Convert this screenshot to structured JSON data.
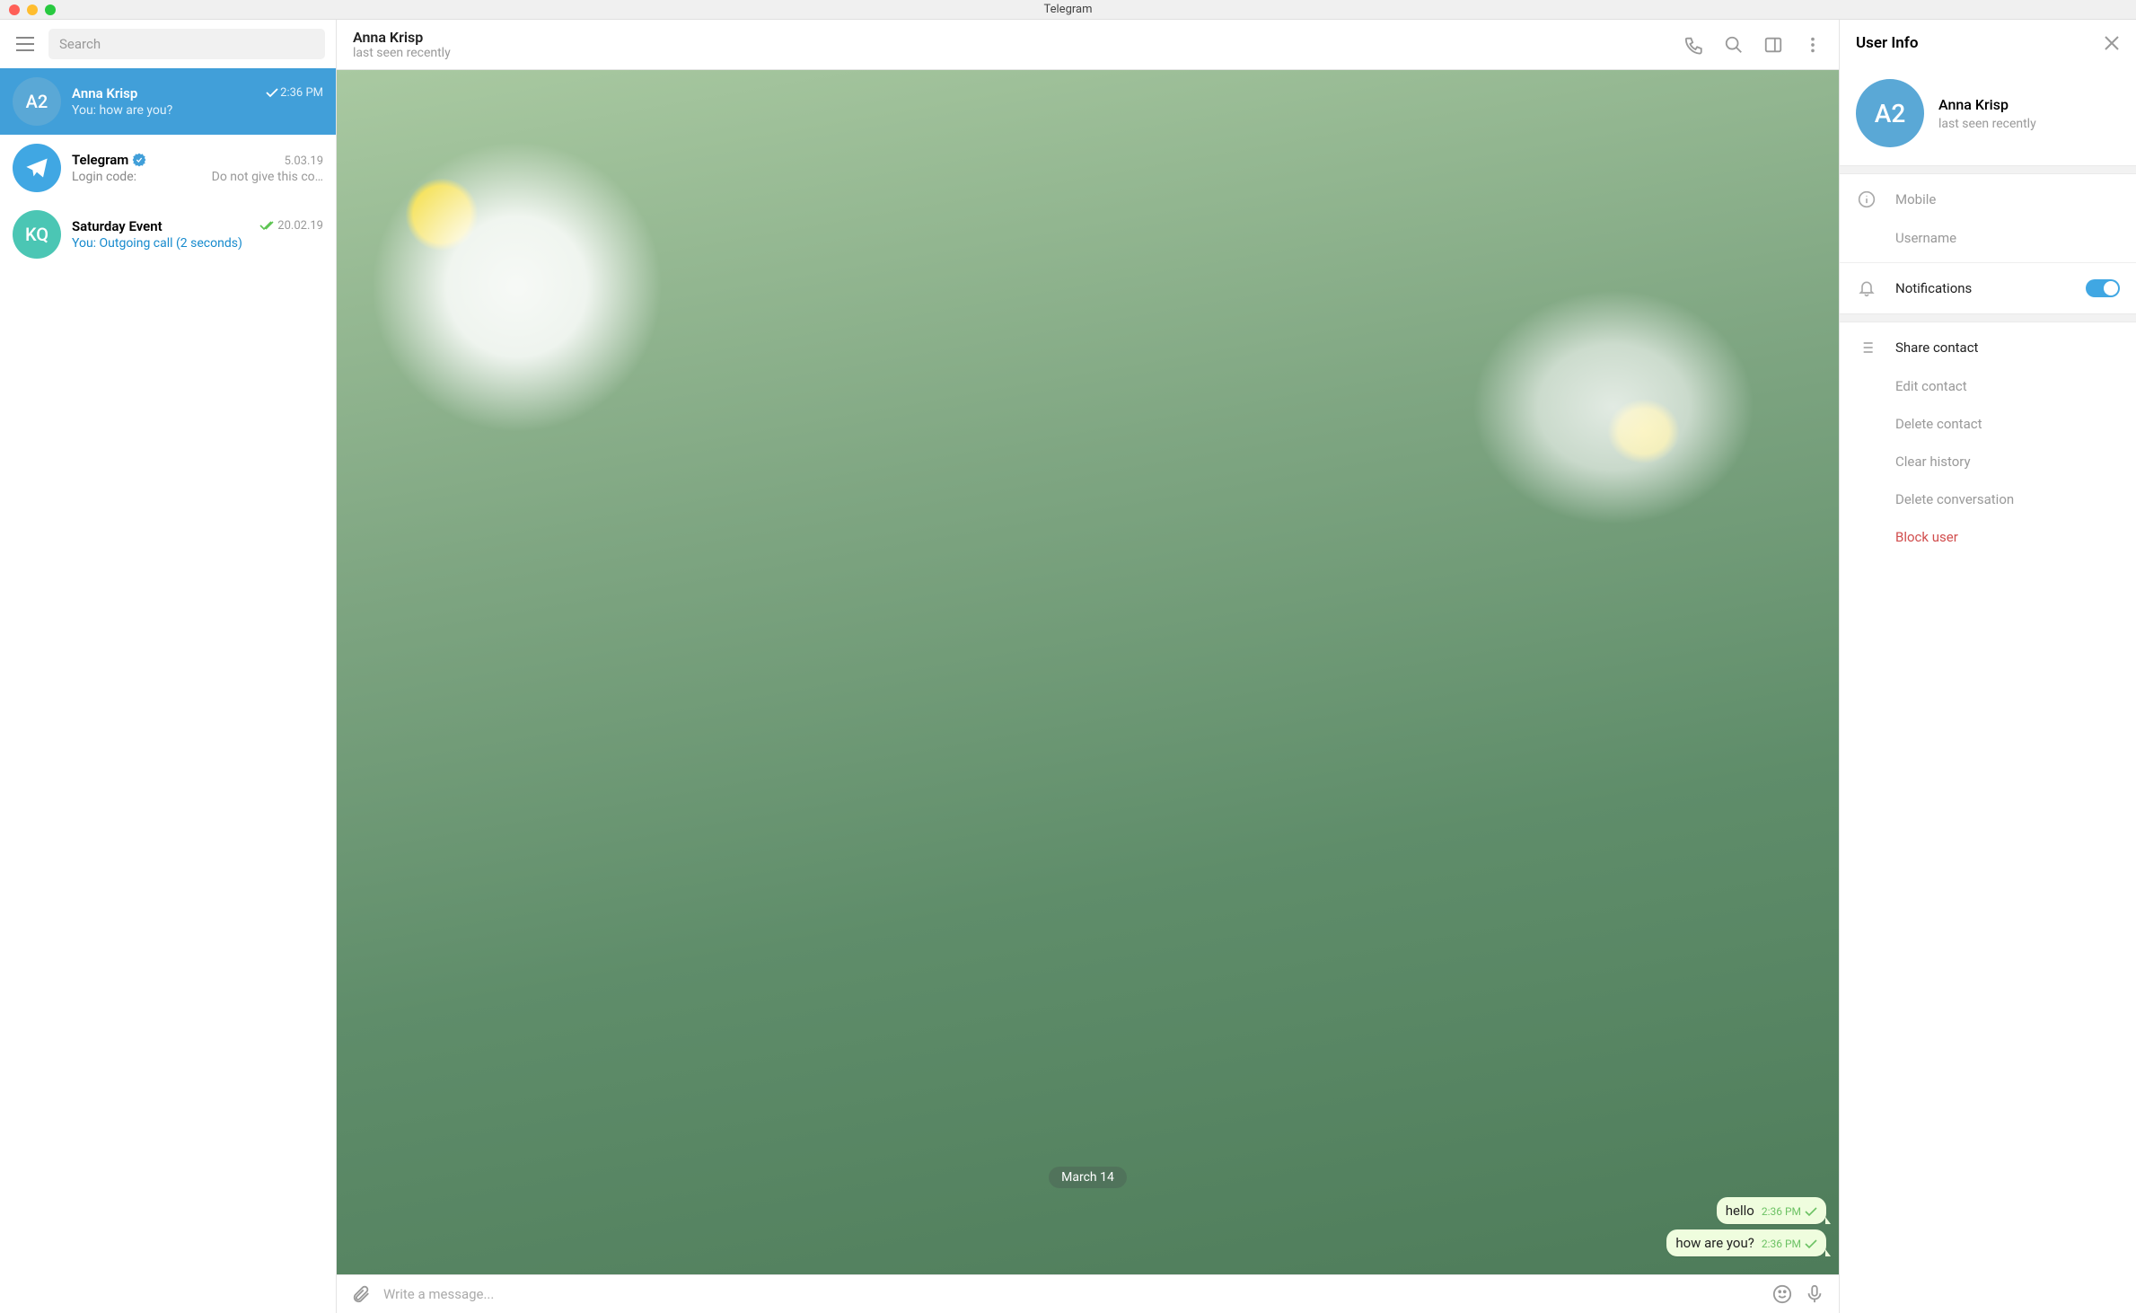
{
  "window": {
    "title": "Telegram"
  },
  "sidebar": {
    "search_placeholder": "Search",
    "chats": [
      {
        "avatar": "A2",
        "avatar_bg": "#5aa8d6",
        "name": "Anna Krisp",
        "time": "2:36 PM",
        "check": "single",
        "preview": "You: how are you?",
        "selected": true
      },
      {
        "avatar": "plane",
        "avatar_bg": "#40A7E3",
        "name": "Telegram",
        "verified": true,
        "time": "5.03.19",
        "preview": "Login code:",
        "subpreview": "Do not give this co…",
        "selected": false
      },
      {
        "avatar": "KQ",
        "avatar_bg": "#4bc6b4",
        "name": "Saturday Event",
        "time": "20.02.19",
        "check": "double",
        "preview": "You: Outgoing call (2 seconds)",
        "preview_link": true,
        "selected": false
      }
    ]
  },
  "chat": {
    "header": {
      "name": "Anna Krisp",
      "status": "last seen recently"
    },
    "date_separator": "March 14",
    "messages": [
      {
        "text": "hello",
        "time": "2:36 PM"
      },
      {
        "text": "how are you?",
        "time": "2:36 PM"
      }
    ],
    "composer_placeholder": "Write a message..."
  },
  "info": {
    "title": "User Info",
    "profile": {
      "avatar": "A2",
      "avatar_bg": "#5aa8d6",
      "name": "Anna Krisp",
      "status": "last seen recently"
    },
    "fields": {
      "mobile": "Mobile",
      "username": "Username",
      "notifications": "Notifications"
    },
    "actions": {
      "share": "Share contact",
      "edit": "Edit contact",
      "delete_contact": "Delete contact",
      "clear": "Clear history",
      "delete_conv": "Delete conversation",
      "block": "Block user"
    }
  }
}
